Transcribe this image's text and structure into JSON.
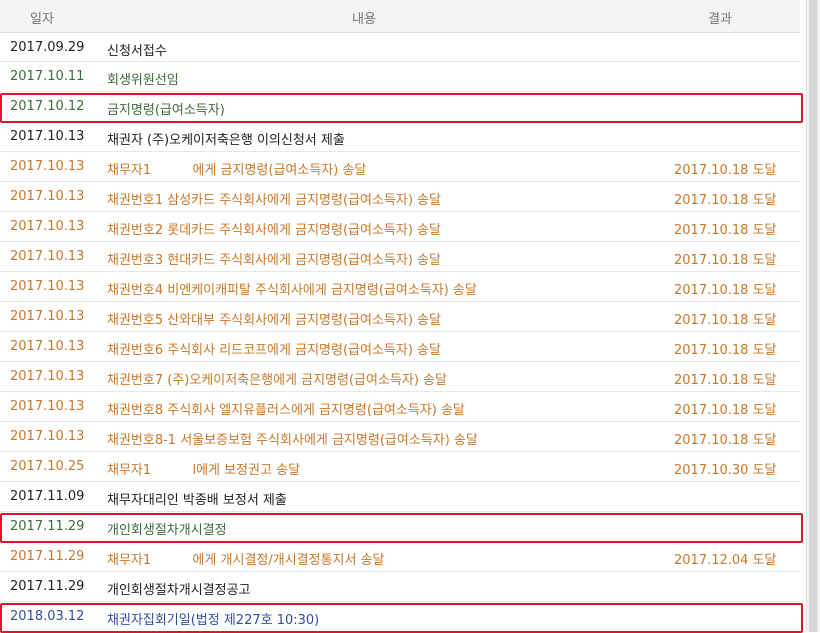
{
  "header": {
    "date": "일자",
    "content": "내용",
    "result": "결과"
  },
  "rows": [
    {
      "date": "2017.09.29",
      "content": "신청서접수",
      "result": "",
      "color": "black",
      "boxed": false
    },
    {
      "date": "2017.10.11",
      "content": "회생위원선임",
      "result": "",
      "color": "green",
      "boxed": false
    },
    {
      "date": "2017.10.12",
      "content": "금지명령(급여소득자)",
      "result": "",
      "color": "green",
      "boxed": true
    },
    {
      "date": "2017.10.13",
      "content": "채권자 (주)오케이저축은행 이의신청서 제출",
      "result": "",
      "color": "black",
      "boxed": false
    },
    {
      "date": "2017.10.13",
      "content": "채무자1          에게 금지명령(급여소득자) 송달",
      "result": "2017.10.18 도달",
      "color": "orange",
      "boxed": false
    },
    {
      "date": "2017.10.13",
      "content": "채권번호1 삼성카드 주식회사에게 금지명령(급여소득자) 송달",
      "result": "2017.10.18 도달",
      "color": "orange",
      "boxed": false
    },
    {
      "date": "2017.10.13",
      "content": "채권번호2 롯데카드 주식회사에게 금지명령(급여소득자) 송달",
      "result": "2017.10.18 도달",
      "color": "orange",
      "boxed": false
    },
    {
      "date": "2017.10.13",
      "content": "채권번호3 현대카드 주식회사에게 금지명령(급여소득자) 송달",
      "result": "2017.10.18 도달",
      "color": "orange",
      "boxed": false
    },
    {
      "date": "2017.10.13",
      "content": "채권번호4 비엔케이캐피탈 주식회사에게 금지명령(급여소득자) 송달",
      "result": "2017.10.18 도달",
      "color": "orange",
      "boxed": false
    },
    {
      "date": "2017.10.13",
      "content": "채권번호5 산와대부 주식회사에게 금지명령(급여소득자) 송달",
      "result": "2017.10.18 도달",
      "color": "orange",
      "boxed": false
    },
    {
      "date": "2017.10.13",
      "content": "채권번호6 주식회사 리드코프에게 금지명령(급여소득자) 송달",
      "result": "2017.10.18 도달",
      "color": "orange",
      "boxed": false
    },
    {
      "date": "2017.10.13",
      "content": "채권번호7 (주)오케이저축은행에게 금지명령(급여소득자) 송달",
      "result": "2017.10.18 도달",
      "color": "orange",
      "boxed": false
    },
    {
      "date": "2017.10.13",
      "content": "채권번호8 주식회사 엘지유플러스에게 금지명령(급여소득자) 송달",
      "result": "2017.10.18 도달",
      "color": "orange",
      "boxed": false
    },
    {
      "date": "2017.10.13",
      "content": "채권번호8-1 서울보증보험 주식회사에게 금지명령(급여소득자) 송달",
      "result": "2017.10.18 도달",
      "color": "orange",
      "boxed": false
    },
    {
      "date": "2017.10.25",
      "content": "채무자1          l에게 보정권고 송달",
      "result": "2017.10.30 도달",
      "color": "orange",
      "boxed": false
    },
    {
      "date": "2017.11.09",
      "content": "채무자대리인 박종배 보정서 제출",
      "result": "",
      "color": "black",
      "boxed": false
    },
    {
      "date": "2017.11.29",
      "content": "개인회생절차개시결정",
      "result": "",
      "color": "green",
      "boxed": true
    },
    {
      "date": "2017.11.29",
      "content": "채무자1          에게 개시결정/개시결정통지서 송달",
      "result": "2017.12.04 도달",
      "color": "orange",
      "boxed": false
    },
    {
      "date": "2017.11.29",
      "content": "개인회생절차개시결정공고",
      "result": "",
      "color": "black",
      "boxed": false
    },
    {
      "date": "2018.03.12",
      "content": "채권자집회기일(법정 제227호 10:30)",
      "result": "",
      "color": "blue",
      "boxed": true
    }
  ]
}
